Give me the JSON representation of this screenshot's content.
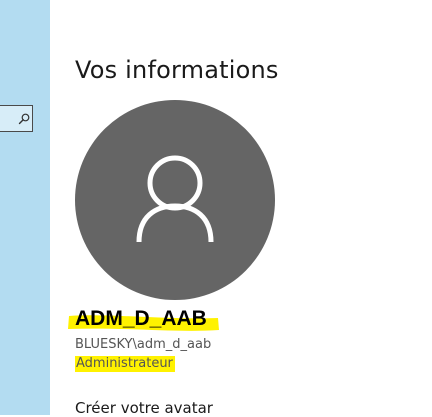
{
  "search": {
    "icon": "search-icon"
  },
  "page": {
    "heading": "Vos informations"
  },
  "account": {
    "avatar_icon": "user-icon",
    "avatar_color": "#656565",
    "name": "ADM_D_AAB",
    "domain_user": "BLUESKY\\adm_d_aab",
    "role": "Administrateur",
    "highlight_color": "#fff200"
  },
  "avatar_section": {
    "create_label": "Créer votre avatar"
  },
  "colors": {
    "sidebar_bg": "#b3dcf1",
    "text": "#1a1a1a"
  }
}
